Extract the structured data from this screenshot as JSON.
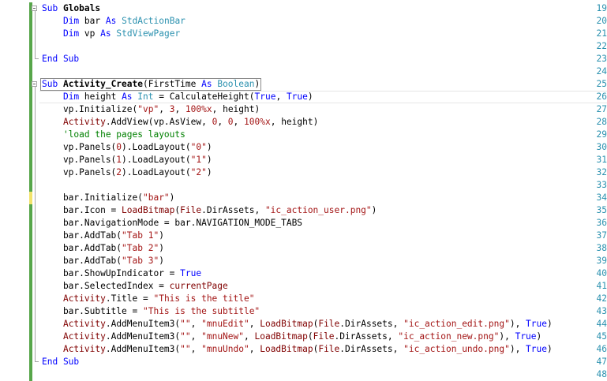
{
  "colors": {
    "line_number": "#2b91af",
    "keyword": "#0000ff",
    "type": "#2b91af",
    "string": "#a31515",
    "comment": "#008000",
    "change_saved": "#57a64a",
    "change_unsaved": "#f2e36b"
  },
  "lines": [
    {
      "num": "19",
      "change": "saved",
      "fold": "box",
      "tokens": [
        {
          "t": "Sub ",
          "c": "kw"
        },
        {
          "t": "Globals",
          "c": "bold"
        }
      ]
    },
    {
      "num": "20",
      "change": "saved",
      "fold": "line",
      "tokens": [
        {
          "t": "    "
        },
        {
          "t": "Dim",
          "c": "kw"
        },
        {
          "t": " bar "
        },
        {
          "t": "As",
          "c": "kw"
        },
        {
          "t": " "
        },
        {
          "t": "StdActionBar",
          "c": "ty"
        }
      ]
    },
    {
      "num": "21",
      "change": "saved",
      "fold": "line",
      "tokens": [
        {
          "t": "    "
        },
        {
          "t": "Dim",
          "c": "kw"
        },
        {
          "t": " vp "
        },
        {
          "t": "As",
          "c": "kw"
        },
        {
          "t": " "
        },
        {
          "t": "StdViewPager",
          "c": "ty"
        }
      ]
    },
    {
      "num": "22",
      "change": "saved",
      "fold": "line",
      "tokens": []
    },
    {
      "num": "23",
      "change": "saved",
      "fold": "end",
      "tokens": [
        {
          "t": "End Sub",
          "c": "kw"
        }
      ]
    },
    {
      "num": "24",
      "change": "saved",
      "fold": "none",
      "tokens": []
    },
    {
      "num": "25",
      "change": "saved",
      "fold": "box",
      "selected": true,
      "tokens": [
        {
          "t": "Sub ",
          "c": "kw"
        },
        {
          "t": "Activity_Create",
          "c": "bold"
        },
        {
          "t": "(FirstTime "
        },
        {
          "t": "As",
          "c": "kw"
        },
        {
          "t": " "
        },
        {
          "t": "Boolean",
          "c": "ty"
        },
        {
          "t": ")"
        }
      ]
    },
    {
      "num": "26",
      "change": "saved",
      "fold": "line",
      "current": true,
      "tokens": [
        {
          "t": "    "
        },
        {
          "t": "Dim",
          "c": "kw"
        },
        {
          "t": " height "
        },
        {
          "t": "As",
          "c": "kw"
        },
        {
          "t": " "
        },
        {
          "t": "Int",
          "c": "ty"
        },
        {
          "t": " = CalculateHeight("
        },
        {
          "t": "True",
          "c": "kw"
        },
        {
          "t": ", "
        },
        {
          "t": "True",
          "c": "kw"
        },
        {
          "t": ")"
        }
      ]
    },
    {
      "num": "27",
      "change": "saved",
      "fold": "line",
      "tokens": [
        {
          "t": "    vp.Initialize("
        },
        {
          "t": "\"vp\"",
          "c": "str"
        },
        {
          "t": ", "
        },
        {
          "t": "3",
          "c": "str"
        },
        {
          "t": ", "
        },
        {
          "t": "100%x",
          "c": "str"
        },
        {
          "t": ", height)"
        }
      ]
    },
    {
      "num": "28",
      "change": "saved",
      "fold": "line",
      "tokens": [
        {
          "t": "    "
        },
        {
          "t": "Activity",
          "c": "var"
        },
        {
          "t": ".AddView(vp.AsView, "
        },
        {
          "t": "0",
          "c": "str"
        },
        {
          "t": ", "
        },
        {
          "t": "0",
          "c": "str"
        },
        {
          "t": ", "
        },
        {
          "t": "100%x",
          "c": "str"
        },
        {
          "t": ", height)"
        }
      ]
    },
    {
      "num": "29",
      "change": "saved",
      "fold": "line",
      "tokens": [
        {
          "t": "    "
        },
        {
          "t": "'load the pages layouts",
          "c": "cm"
        }
      ]
    },
    {
      "num": "30",
      "change": "saved",
      "fold": "line",
      "tokens": [
        {
          "t": "    vp.Panels("
        },
        {
          "t": "0",
          "c": "str"
        },
        {
          "t": ").LoadLayout("
        },
        {
          "t": "\"0\"",
          "c": "str"
        },
        {
          "t": ")"
        }
      ]
    },
    {
      "num": "31",
      "change": "saved",
      "fold": "line",
      "tokens": [
        {
          "t": "    vp.Panels("
        },
        {
          "t": "1",
          "c": "str"
        },
        {
          "t": ").LoadLayout("
        },
        {
          "t": "\"1\"",
          "c": "str"
        },
        {
          "t": ")"
        }
      ]
    },
    {
      "num": "32",
      "change": "saved",
      "fold": "line",
      "tokens": [
        {
          "t": "    vp.Panels("
        },
        {
          "t": "2",
          "c": "str"
        },
        {
          "t": ").LoadLayout("
        },
        {
          "t": "\"2\"",
          "c": "str"
        },
        {
          "t": ")"
        }
      ]
    },
    {
      "num": "33",
      "change": "saved",
      "fold": "line",
      "tokens": []
    },
    {
      "num": "34",
      "change": "unsaved",
      "fold": "line",
      "tokens": [
        {
          "t": "    bar.Initialize("
        },
        {
          "t": "\"bar\"",
          "c": "str"
        },
        {
          "t": ")"
        }
      ]
    },
    {
      "num": "35",
      "change": "saved",
      "fold": "line",
      "tokens": [
        {
          "t": "    bar.Icon = "
        },
        {
          "t": "LoadBitmap",
          "c": "var"
        },
        {
          "t": "("
        },
        {
          "t": "File",
          "c": "var"
        },
        {
          "t": ".DirAssets, "
        },
        {
          "t": "\"ic_action_user.png\"",
          "c": "str"
        },
        {
          "t": ")"
        }
      ]
    },
    {
      "num": "36",
      "change": "saved",
      "fold": "line",
      "tokens": [
        {
          "t": "    bar.NavigationMode = bar.NAVIGATION_MODE_TABS"
        }
      ]
    },
    {
      "num": "37",
      "change": "saved",
      "fold": "line",
      "tokens": [
        {
          "t": "    bar.AddTab("
        },
        {
          "t": "\"Tab 1\"",
          "c": "str"
        },
        {
          "t": ")"
        }
      ]
    },
    {
      "num": "38",
      "change": "saved",
      "fold": "line",
      "tokens": [
        {
          "t": "    bar.AddTab("
        },
        {
          "t": "\"Tab 2\"",
          "c": "str"
        },
        {
          "t": ")"
        }
      ]
    },
    {
      "num": "39",
      "change": "saved",
      "fold": "line",
      "tokens": [
        {
          "t": "    bar.AddTab("
        },
        {
          "t": "\"Tab 3\"",
          "c": "str"
        },
        {
          "t": ")"
        }
      ]
    },
    {
      "num": "40",
      "change": "saved",
      "fold": "line",
      "tokens": [
        {
          "t": "    bar.ShowUpIndicator = "
        },
        {
          "t": "True",
          "c": "kw"
        }
      ]
    },
    {
      "num": "41",
      "change": "saved",
      "fold": "line",
      "tokens": [
        {
          "t": "    bar.SelectedIndex = "
        },
        {
          "t": "currentPage",
          "c": "var"
        }
      ]
    },
    {
      "num": "42",
      "change": "saved",
      "fold": "line",
      "tokens": [
        {
          "t": "    "
        },
        {
          "t": "Activity",
          "c": "var"
        },
        {
          "t": ".Title = "
        },
        {
          "t": "\"This is the title\"",
          "c": "str"
        }
      ]
    },
    {
      "num": "43",
      "change": "saved",
      "fold": "line",
      "tokens": [
        {
          "t": "    bar.Subtitle = "
        },
        {
          "t": "\"This is the subtitle\"",
          "c": "str"
        }
      ]
    },
    {
      "num": "44",
      "change": "saved",
      "fold": "line",
      "tokens": [
        {
          "t": "    "
        },
        {
          "t": "Activity",
          "c": "var"
        },
        {
          "t": ".AddMenuItem3("
        },
        {
          "t": "\"\"",
          "c": "str"
        },
        {
          "t": ", "
        },
        {
          "t": "\"mnuEdit\"",
          "c": "str"
        },
        {
          "t": ", "
        },
        {
          "t": "LoadBitmap",
          "c": "var"
        },
        {
          "t": "("
        },
        {
          "t": "File",
          "c": "var"
        },
        {
          "t": ".DirAssets, "
        },
        {
          "t": "\"ic_action_edit.png\"",
          "c": "str"
        },
        {
          "t": "), "
        },
        {
          "t": "True",
          "c": "kw"
        },
        {
          "t": ")"
        }
      ]
    },
    {
      "num": "45",
      "change": "saved",
      "fold": "line",
      "tokens": [
        {
          "t": "    "
        },
        {
          "t": "Activity",
          "c": "var"
        },
        {
          "t": ".AddMenuItem3("
        },
        {
          "t": "\"\"",
          "c": "str"
        },
        {
          "t": ", "
        },
        {
          "t": "\"mnuNew\"",
          "c": "str"
        },
        {
          "t": ", "
        },
        {
          "t": "LoadBitmap",
          "c": "var"
        },
        {
          "t": "("
        },
        {
          "t": "File",
          "c": "var"
        },
        {
          "t": ".DirAssets, "
        },
        {
          "t": "\"ic_action_new.png\"",
          "c": "str"
        },
        {
          "t": "), "
        },
        {
          "t": "True",
          "c": "kw"
        },
        {
          "t": ")"
        }
      ]
    },
    {
      "num": "46",
      "change": "saved",
      "fold": "line",
      "tokens": [
        {
          "t": "    "
        },
        {
          "t": "Activity",
          "c": "var"
        },
        {
          "t": ".AddMenuItem3("
        },
        {
          "t": "\"\"",
          "c": "str"
        },
        {
          "t": ", "
        },
        {
          "t": "\"mnuUndo\"",
          "c": "str"
        },
        {
          "t": ", "
        },
        {
          "t": "LoadBitmap",
          "c": "var"
        },
        {
          "t": "("
        },
        {
          "t": "File",
          "c": "var"
        },
        {
          "t": ".DirAssets, "
        },
        {
          "t": "\"ic_action_undo.png\"",
          "c": "str"
        },
        {
          "t": "), "
        },
        {
          "t": "True",
          "c": "kw"
        },
        {
          "t": ")"
        }
      ]
    },
    {
      "num": "47",
      "change": "saved",
      "fold": "end",
      "tokens": [
        {
          "t": "End Sub",
          "c": "kw"
        }
      ]
    },
    {
      "num": "48",
      "change": "saved",
      "fold": "none",
      "tokens": []
    }
  ]
}
